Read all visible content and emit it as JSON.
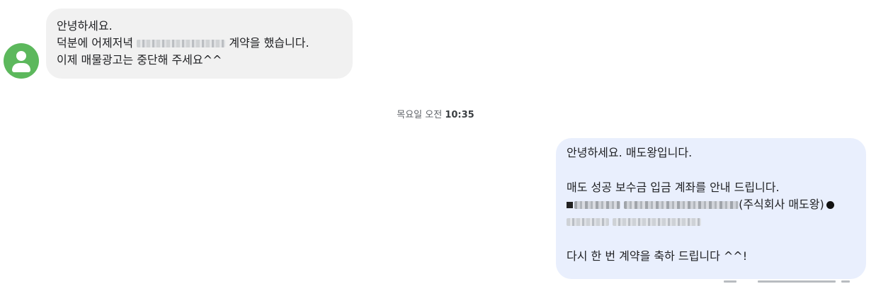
{
  "incoming": {
    "lines": [
      "안녕하세요.",
      "덕분에 어제저녁",
      "계약을 했습니다.",
      "이제 매물광고는 중단해 주세요^^"
    ]
  },
  "timestamp": {
    "day": "목요일 오전",
    "time": "10:35"
  },
  "outgoing": {
    "greeting": "안녕하세요. 매도왕입니다.",
    "notice": "매도 성공 보수금 입금 계좌를 안내 드립니다.",
    "holder": "(주식회사 매도왕)",
    "closing": "다시 한 번 계약을 축하 드립니다 ^^!"
  },
  "colors": {
    "avatar": "#5cb85c",
    "incoming_bubble": "#f1f1f1",
    "outgoing_bubble": "#e9effd"
  }
}
